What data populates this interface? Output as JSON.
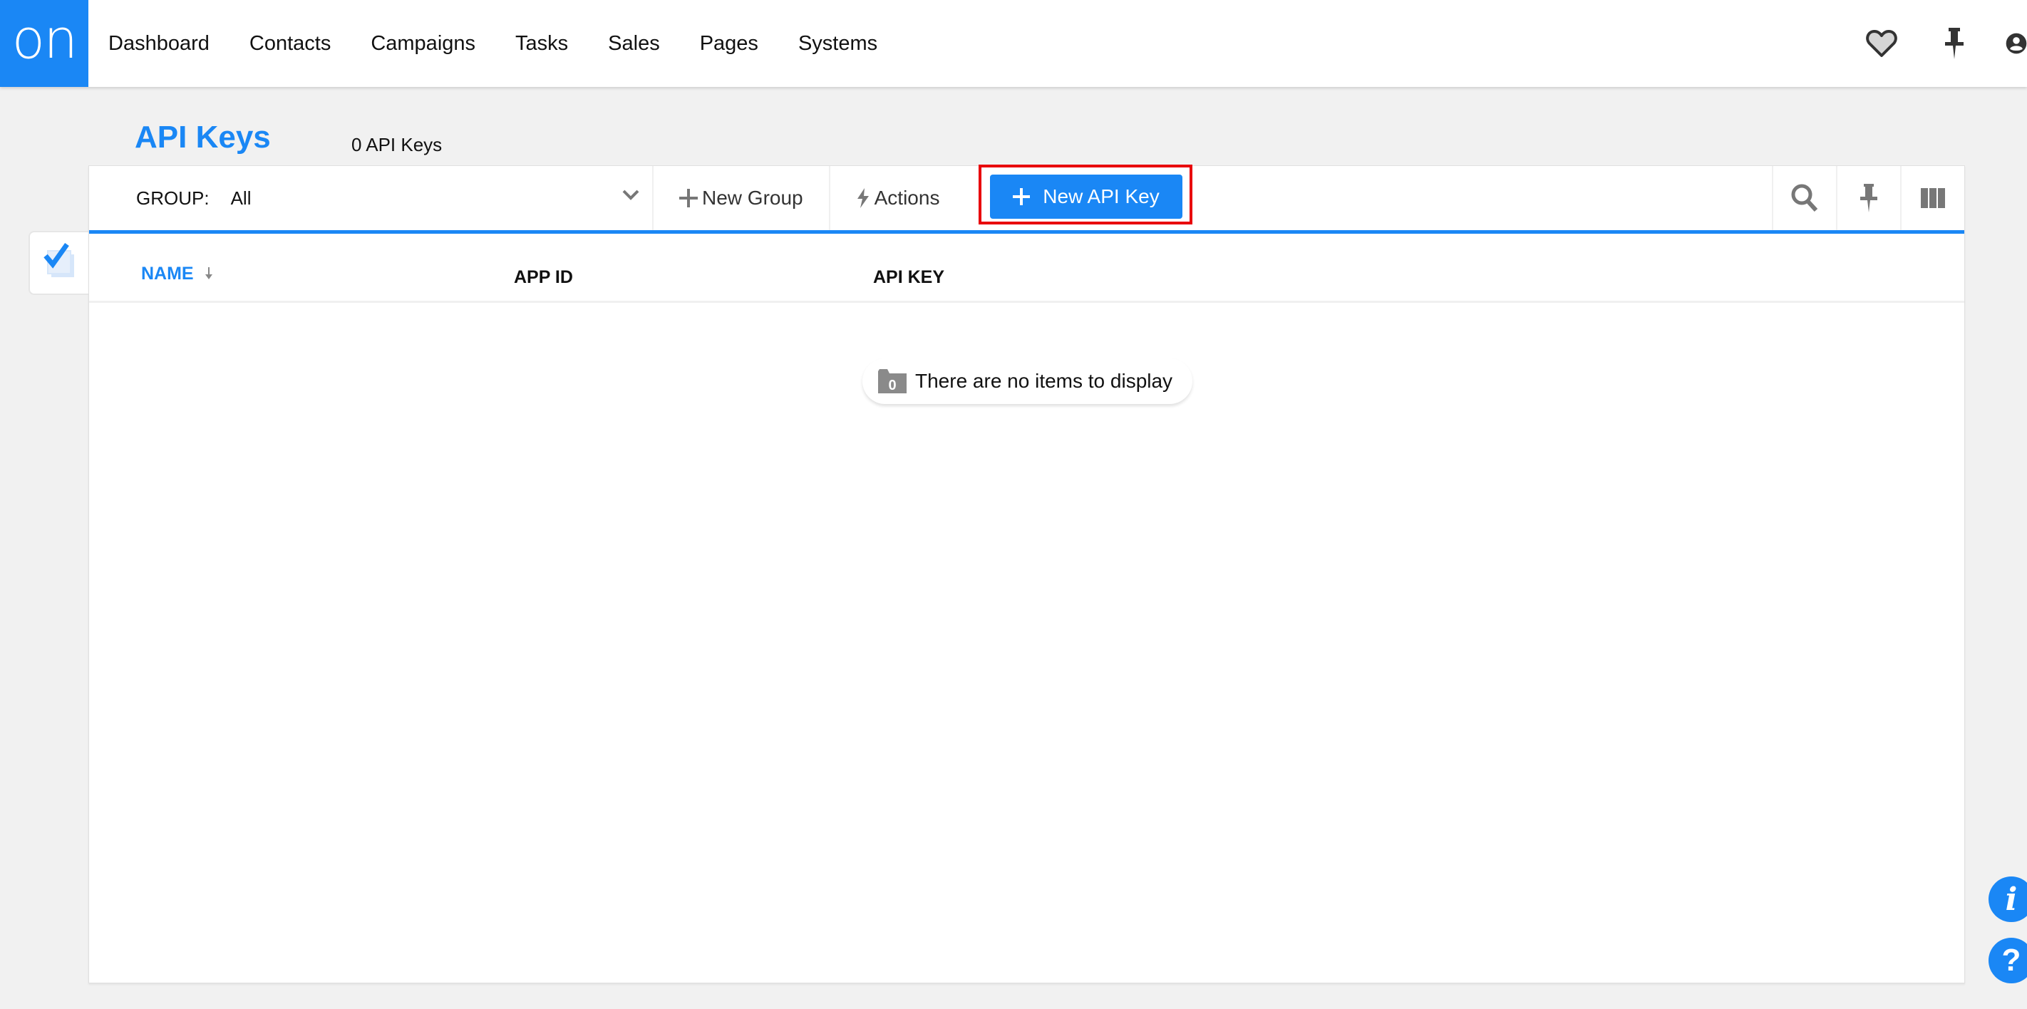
{
  "app": {
    "logo_text": "on",
    "brand_color": "#1a87f5"
  },
  "nav": {
    "items": [
      "Dashboard",
      "Contacts",
      "Campaigns",
      "Tasks",
      "Sales",
      "Pages",
      "Systems"
    ]
  },
  "top_icons": [
    "heart-icon",
    "pin-icon",
    "user-icon"
  ],
  "page": {
    "title": "API Keys",
    "count": "0 API Keys"
  },
  "toolbar": {
    "group_label": "GROUP:",
    "group_value": "All",
    "new_group_label": "New Group",
    "actions_label": "Actions",
    "new_api_key_label": "New API Key",
    "right_icons": [
      "search-icon",
      "pin-icon",
      "columns-icon"
    ]
  },
  "table": {
    "columns": [
      {
        "label": "NAME",
        "sorted": "descending"
      },
      {
        "label": "APP ID"
      },
      {
        "label": "API KEY"
      }
    ],
    "rows": [],
    "empty_message": "There are no items to display",
    "empty_badge": "0"
  },
  "floating": {
    "info_label": "i",
    "help_label": "?"
  },
  "colors": {
    "accent": "#1a87f5",
    "highlight": "#e8000b",
    "background": "#f1f1f1"
  }
}
